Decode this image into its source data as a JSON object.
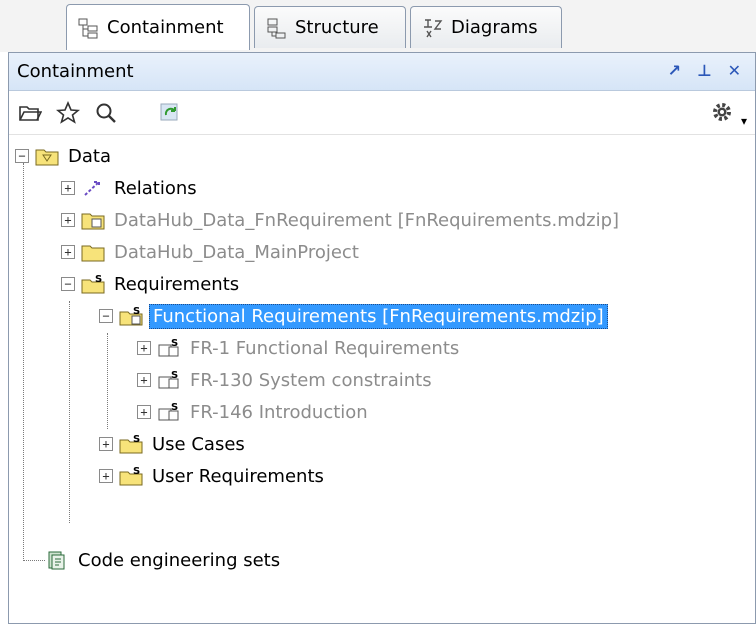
{
  "tabs": [
    {
      "label": "Containment",
      "icon": "containment-icon",
      "active": true
    },
    {
      "label": "Structure",
      "icon": "structure-icon",
      "active": false
    },
    {
      "label": "Diagrams",
      "icon": "diagrams-icon",
      "active": false
    }
  ],
  "panel": {
    "title": "Containment",
    "controls": [
      "restore-icon",
      "pin-icon",
      "close-icon"
    ]
  },
  "toolbar": {
    "buttons": [
      "open-folder-icon",
      "star-icon",
      "search-icon",
      "refresh-icon"
    ],
    "settings_icon": "gear-icon"
  },
  "tree": {
    "root": "Data",
    "relations": "Relations",
    "fn_requirement": "DataHub_Data_FnRequirement [FnRequirements.mdzip]",
    "main_project": "DataHub_Data_MainProject",
    "requirements": "Requirements",
    "functional": "Functional Requirements [FnRequirements.mdzip]",
    "fr1": "FR-1 Functional Requirements",
    "fr130": "FR-130 System constraints",
    "fr146": "FR-146 Introduction",
    "use_cases": "Use Cases",
    "user_requirements": "User Requirements",
    "code_sets": "Code engineering sets"
  },
  "colors": {
    "selection": "#3399ff",
    "folder": "#f7e37a",
    "gray_text": "#8c8c8c"
  }
}
